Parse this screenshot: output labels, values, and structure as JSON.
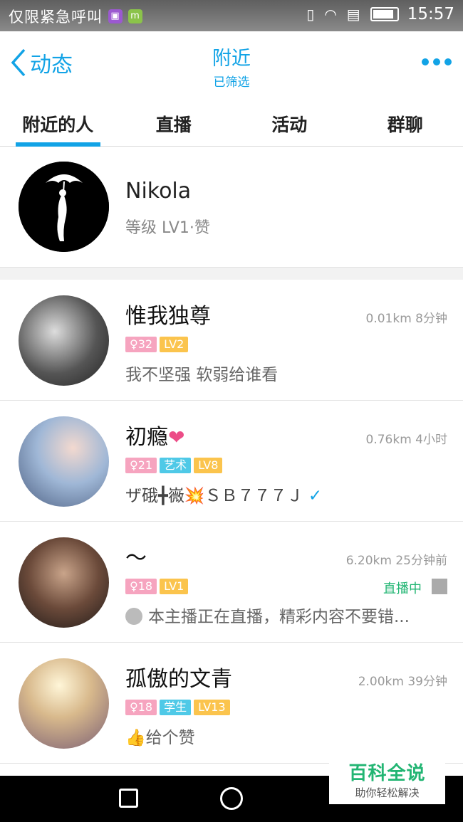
{
  "status_bar": {
    "carrier_text": "仅限紧急呼叫",
    "time": "15:57"
  },
  "header": {
    "back_label": "动态",
    "title": "附近",
    "subtitle": "已筛选"
  },
  "tabs": [
    {
      "label": "附近的人",
      "active": true
    },
    {
      "label": "直播",
      "active": false
    },
    {
      "label": "活动",
      "active": false
    },
    {
      "label": "群聊",
      "active": false
    }
  ],
  "me": {
    "name": "Nikola",
    "sub": "等级 LV1·赞"
  },
  "list": [
    {
      "nick": "惟我独尊",
      "meta": "0.01km 8分钟",
      "age": "32",
      "level": "LV2",
      "desc": "我不坚强    软弱给谁看"
    },
    {
      "nick": "初瘾",
      "meta": "0.76km 4小时",
      "age": "21",
      "tag": "艺术",
      "level": "LV8",
      "desc": "ザ硪╋嶶💥ＳＢ７７７Ｊ"
    },
    {
      "nick": "～",
      "meta": "6.20km 25分钟前",
      "age": "18",
      "level": "LV1",
      "live": "直播中",
      "desc": "本主播正在直播，精彩内容不要错..."
    },
    {
      "nick": "孤傲的文青",
      "meta": "2.00km 39分钟",
      "age": "18",
      "tag": "学生",
      "level": "LV13",
      "desc": "👍给个赞"
    }
  ],
  "watermark": {
    "title": "百科全说",
    "subtitle": "助你轻松解决"
  }
}
